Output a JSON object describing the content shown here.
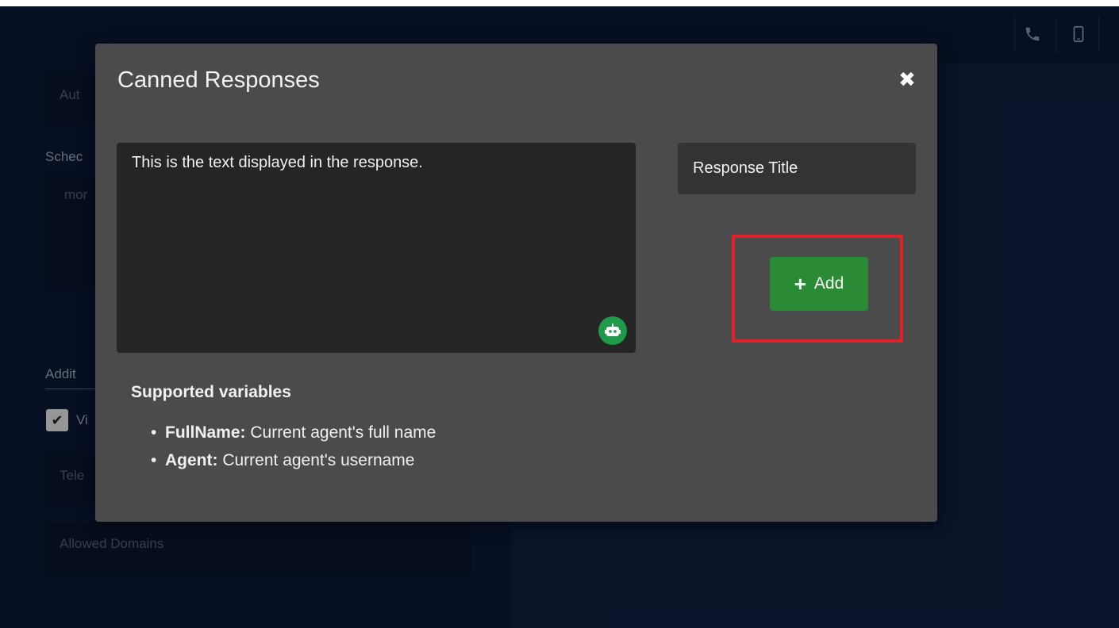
{
  "background": {
    "fields": {
      "auto_prefix": "Aut",
      "schedule_label_prefix": "Schec",
      "schedule_value_prefix": "mor",
      "additional_label_prefix": "Addit",
      "checkbox_label_prefix": "Vi",
      "tele_prefix": "Tele",
      "allowed_domains_placeholder": "Allowed Domains"
    },
    "topbar_icons": [
      "phone-icon",
      "mobile-icon"
    ]
  },
  "modal": {
    "title": "Canned Responses",
    "close_label": "✖",
    "response_text": "This is the text displayed in the response.",
    "title_placeholder": "Response Title",
    "add_button_label": "Add",
    "supported_variables": {
      "heading": "Supported variables",
      "items": [
        {
          "name": "FullName:",
          "description": " Current agent's full name"
        },
        {
          "name": "Agent:",
          "description": " Current agent's username"
        }
      ]
    }
  },
  "colors": {
    "modal_bg": "#4b4b4b",
    "add_button": "#2a8a35",
    "highlight": "#e2202a",
    "bot_icon": "#1f9a4b"
  }
}
